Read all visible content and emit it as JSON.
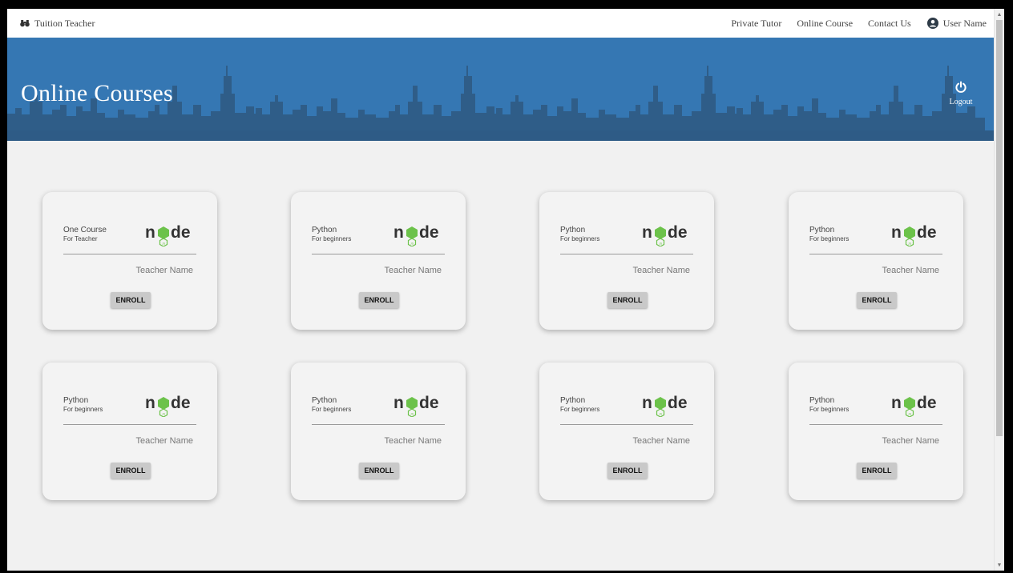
{
  "nav": {
    "brand": "Tuition Teacher",
    "brand_icon": "binoculars-icon",
    "links": [
      "Private Tutor",
      "Online Course",
      "Contact Us"
    ],
    "user_name": "User Name",
    "user_icon": "user-avatar-icon"
  },
  "hero": {
    "title": "Online Courses",
    "logout_label": "Logout",
    "logout_icon": "power-icon",
    "background_color": "#3577b3"
  },
  "courses": [
    {
      "title": "One Course",
      "subtitle": "For Teacher",
      "teacher": "Teacher Name",
      "button": "ENROLL",
      "logo": "node"
    },
    {
      "title": "Python",
      "subtitle": "For beginners",
      "teacher": "Teacher Name",
      "button": "ENROLL",
      "logo": "node"
    },
    {
      "title": "Python",
      "subtitle": "For beginners",
      "teacher": "Teacher Name",
      "button": "ENROLL",
      "logo": "node"
    },
    {
      "title": "Python",
      "subtitle": "For beginners",
      "teacher": "Teacher Name",
      "button": "ENROLL",
      "logo": "node"
    },
    {
      "title": "Python",
      "subtitle": "For beginners",
      "teacher": "Teacher Name",
      "button": "ENROLL",
      "logo": "node"
    },
    {
      "title": "Python",
      "subtitle": "For beginners",
      "teacher": "Teacher Name",
      "button": "ENROLL",
      "logo": "node"
    },
    {
      "title": "Python",
      "subtitle": "For beginners",
      "teacher": "Teacher Name",
      "button": "ENROLL",
      "logo": "node"
    },
    {
      "title": "Python",
      "subtitle": "For beginners",
      "teacher": "Teacher Name",
      "button": "ENROLL",
      "logo": "node"
    }
  ],
  "colors": {
    "node_dark": "#333333",
    "node_green": "#6cc24a",
    "page_background": "#f1f1f1"
  }
}
